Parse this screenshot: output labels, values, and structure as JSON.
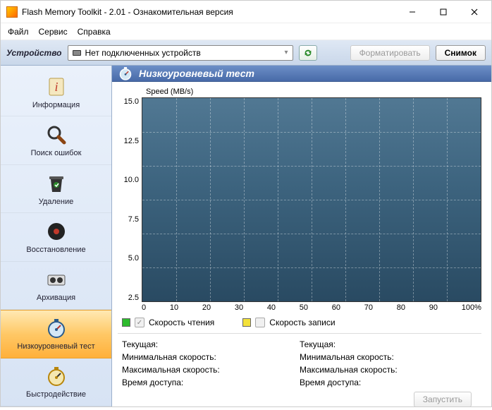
{
  "window": {
    "title": "Flash Memory Toolkit - 2.01 - Ознакомительная версия"
  },
  "menu": {
    "file": "Файл",
    "service": "Сервис",
    "help": "Справка"
  },
  "toolbar": {
    "device_label": "Устройство",
    "device_value": "Нет подключенных устройств",
    "format_btn": "Форматировать",
    "snapshot_btn": "Снимок"
  },
  "sidebar": {
    "items": [
      {
        "key": "info",
        "label": "Информация"
      },
      {
        "key": "errors",
        "label": "Поиск ошибок"
      },
      {
        "key": "delete",
        "label": "Удаление"
      },
      {
        "key": "recover",
        "label": "Восстановление"
      },
      {
        "key": "archive",
        "label": "Архивация"
      },
      {
        "key": "lowlevel",
        "label": "Низкоуровневый тест"
      },
      {
        "key": "perf",
        "label": "Быстродействие"
      }
    ]
  },
  "panel": {
    "title": "Низкоуровневый тест",
    "chart_label": "Speed (MB/s)",
    "legend_read": "Скорость чтения",
    "legend_write": "Скорость записи",
    "stats": {
      "current": "Текущая:",
      "min": "Минимальная скорость:",
      "max": "Максимальная скорость:",
      "access": "Время доступа:"
    },
    "run_btn": "Запустить"
  },
  "chart_data": {
    "type": "line",
    "title": "Speed (MB/s)",
    "xlabel": "",
    "ylabel": "Speed",
    "x_ticks": [
      "0",
      "10",
      "20",
      "30",
      "40",
      "50",
      "60",
      "70",
      "80",
      "90",
      "100%"
    ],
    "y_ticks": [
      "15.0",
      "12.5",
      "10.0",
      "7.5",
      "5.0",
      "2.5"
    ],
    "xlim": [
      0,
      100
    ],
    "ylim": [
      0,
      15
    ],
    "series": [
      {
        "name": "Скорость чтения",
        "color": "#2dbb2d",
        "values": []
      },
      {
        "name": "Скорость записи",
        "color": "#f3e13a",
        "values": []
      }
    ]
  }
}
